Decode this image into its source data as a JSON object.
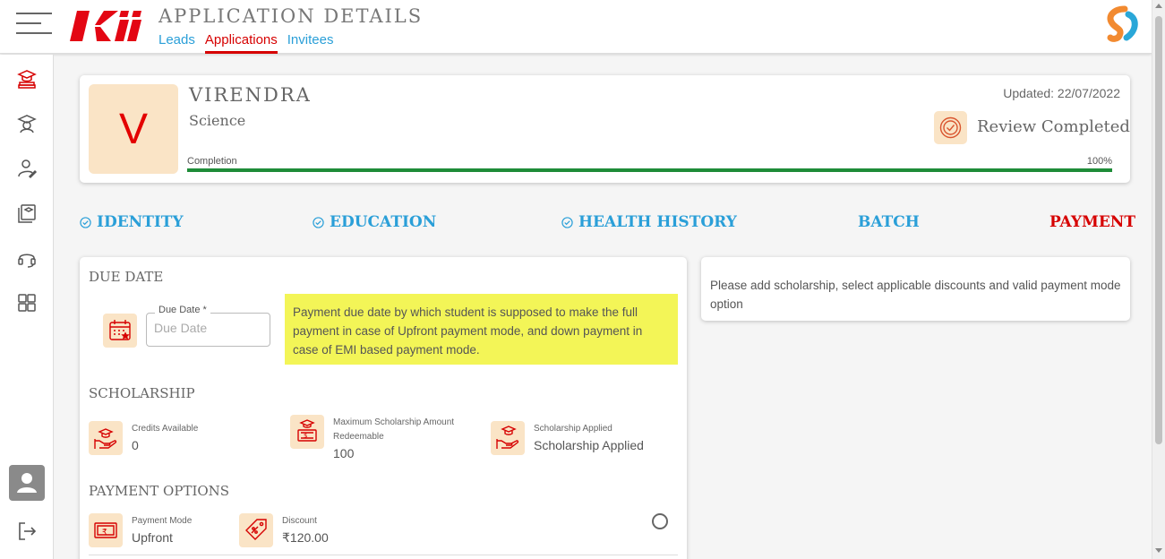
{
  "header": {
    "title": "APPLICATION DETAILS",
    "tabs": [
      {
        "label": "Leads",
        "active": false
      },
      {
        "label": "Applications",
        "active": true
      },
      {
        "label": "Invitees",
        "active": false
      }
    ]
  },
  "sidebar": {
    "items": [
      "graduation-stack-icon",
      "student-icon",
      "user-edit-icon",
      "courses-icon",
      "headset-icon",
      "dashboard-icon",
      "avatar-icon",
      "logout-icon"
    ]
  },
  "profile": {
    "initial": "V",
    "name": "VIRENDRA",
    "stream": "Science",
    "updated": "Updated: 22/07/2022",
    "status": "Review Completed",
    "completion_label": "Completion",
    "completion_pct": "100%",
    "completion_value": 1.0
  },
  "steps": [
    {
      "label": "IDENTITY",
      "done": true
    },
    {
      "label": "EDUCATION",
      "done": true
    },
    {
      "label": "HEALTH HISTORY",
      "done": true
    },
    {
      "label": "BATCH",
      "done": false
    },
    {
      "label": "PAYMENT",
      "done": false,
      "active": true
    }
  ],
  "due_date": {
    "section_title": "DUE DATE",
    "field_label": "Due Date *",
    "placeholder": "Due Date",
    "note": "Payment due date by which student is supposed to make the full payment in case of Upfront payment mode, and down payment in case of EMI based payment mode."
  },
  "scholarship": {
    "section_title": "SCHOLARSHIP",
    "credits_label": "Credits Available",
    "credits_value": "0",
    "max_label": "Maximum Scholarship Amount Redeemable",
    "max_value": "100",
    "applied_label": "Scholarship Applied",
    "applied_value": "Scholarship Applied"
  },
  "payment_options": {
    "section_title": "PAYMENT OPTIONS",
    "mode_label": "Payment Mode",
    "mode_value": "Upfront",
    "discount_label": "Discount",
    "discount_value": "₹120.00"
  },
  "info_panel": {
    "text": "Please add scholarship, select applicable discounts and valid payment mode option"
  },
  "colors": {
    "accent_blue": "#2a9fd8",
    "accent_red": "#d60000",
    "icon_tile": "#fae4c6",
    "note_bg": "#f3f557",
    "progress": "#1e8c38"
  }
}
